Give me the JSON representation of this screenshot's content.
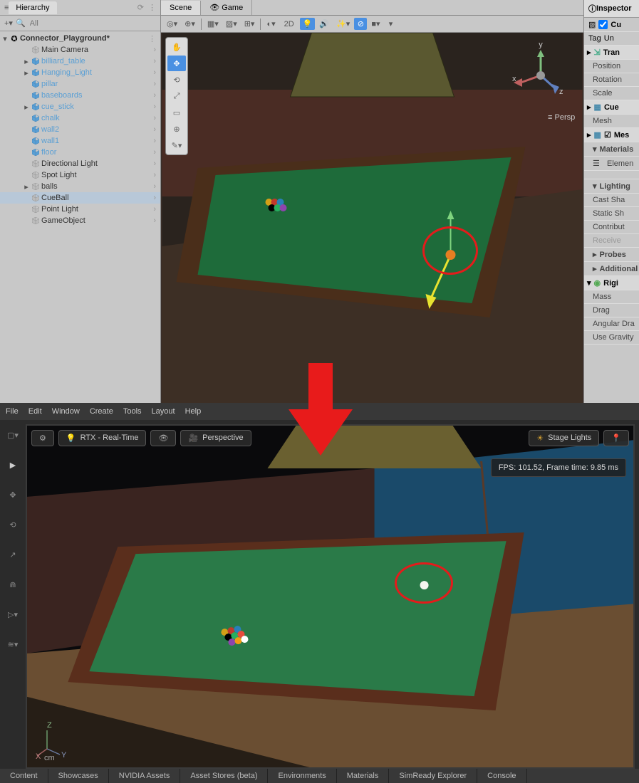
{
  "unity": {
    "hierarchy": {
      "title": "Hierarchy",
      "search_placeholder": "All",
      "root": "Connector_Playground*",
      "items": [
        {
          "label": "Main Camera",
          "blue": false,
          "indent": 1,
          "arrow": ""
        },
        {
          "label": "billiard_table",
          "blue": true,
          "indent": 1,
          "arrow": "▸"
        },
        {
          "label": "Hanging_Light",
          "blue": true,
          "indent": 1,
          "arrow": "▸"
        },
        {
          "label": "pillar",
          "blue": true,
          "indent": 1,
          "arrow": ""
        },
        {
          "label": "baseboards",
          "blue": true,
          "indent": 1,
          "arrow": ""
        },
        {
          "label": "cue_stick",
          "blue": true,
          "indent": 1,
          "arrow": "▸",
          "selected": true
        },
        {
          "label": "chalk",
          "blue": true,
          "indent": 1,
          "arrow": ""
        },
        {
          "label": "wall2",
          "blue": true,
          "indent": 1,
          "arrow": ""
        },
        {
          "label": "wall1",
          "blue": true,
          "indent": 1,
          "arrow": ""
        },
        {
          "label": "floor",
          "blue": true,
          "indent": 1,
          "arrow": ""
        },
        {
          "label": "Directional Light",
          "blue": false,
          "indent": 1,
          "arrow": ""
        },
        {
          "label": "Spot Light",
          "blue": false,
          "indent": 1,
          "arrow": ""
        },
        {
          "label": "balls",
          "blue": false,
          "indent": 1,
          "arrow": "▸"
        },
        {
          "label": "CueBall",
          "blue": false,
          "indent": 1,
          "arrow": "",
          "highlight": true
        },
        {
          "label": "Point Light",
          "blue": false,
          "indent": 1,
          "arrow": ""
        },
        {
          "label": "GameObject",
          "blue": false,
          "indent": 1,
          "arrow": ""
        }
      ]
    },
    "tabs": {
      "scene": "Scene",
      "game": "Game"
    },
    "toolbar": {
      "mode_2d": "2D"
    },
    "gizmo": {
      "x": "x",
      "y": "y",
      "z": "z",
      "persp": "Persp"
    },
    "inspector": {
      "title": "Inspector",
      "cu_label": "Cu",
      "tag_label": "Tag",
      "tag_value": "Un",
      "sections": {
        "transform": "Tran",
        "position": "Position",
        "rotation": "Rotation",
        "scale": "Scale",
        "cue": "Cue",
        "mesh": "Mesh",
        "mesh2": "Mes",
        "materials": "Materials",
        "element": "Elemen",
        "lighting": "Lighting",
        "cast": "Cast Sha",
        "static": "Static Sh",
        "contrib": "Contribut",
        "receive": "Receive",
        "probes": "Probes",
        "additional": "Additional S",
        "rigid": "Rigi",
        "mass": "Mass",
        "drag": "Drag",
        "angular": "Angular Dra",
        "gravity": "Use Gravity"
      }
    }
  },
  "omniverse": {
    "menu": [
      "File",
      "Edit",
      "Window",
      "Create",
      "Tools",
      "Layout",
      "Help"
    ],
    "topbar": {
      "rtx": "RTX - Real-Time",
      "perspective": "Perspective",
      "stage_lights": "Stage Lights"
    },
    "stats": {
      "fps_label": "FPS:",
      "fps_value": "101.52,",
      "frametime_label": "Frame time:",
      "frametime_value": "9.85 ms"
    },
    "axes": {
      "x": "X",
      "y": "Y",
      "z": "Z",
      "unit": "cm"
    },
    "bottombar": [
      "Content",
      "Showcases",
      "NVIDIA Assets",
      "Asset Stores (beta)",
      "Environments",
      "Materials",
      "SimReady Explorer",
      "Console"
    ]
  }
}
